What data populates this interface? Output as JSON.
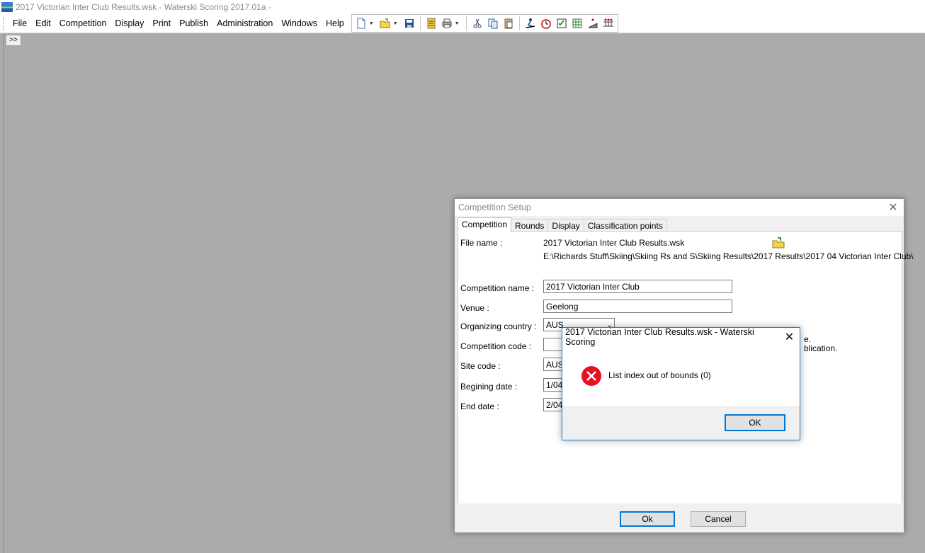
{
  "window": {
    "title": "2017 Victorian Inter Club Results.wsk - Waterski Scoring 2017.01a  -"
  },
  "menu": [
    "File",
    "Edit",
    "Competition",
    "Display",
    "Print",
    "Publish",
    "Administration",
    "Windows",
    "Help"
  ],
  "mdi": {
    "expand_label": ">>"
  },
  "setup_dialog": {
    "title": "Competition Setup",
    "tabs": [
      "Competition",
      "Rounds",
      "Display",
      "Classification points"
    ],
    "file_name_label": "File name :",
    "file_name_value": "2017 Victorian Inter Club Results.wsk",
    "file_path_value": "E:\\Richards Stuff\\Skiing\\Skiing Rs and S\\Skiing Results\\2017 Results\\2017 04 Victorian Inter Club\\",
    "competition_name_label": "Competition name :",
    "competition_name_value": "2017 Victorian Inter Club",
    "venue_label": "Venue :",
    "venue_value": "Geelong",
    "organizing_country_label": "Organizing country :",
    "organizing_country_value": "AUS",
    "competition_code_label": "Competition code :",
    "competition_code_value": "",
    "site_code_label": "Site code :",
    "site_code_value": "AUS3",
    "begin_date_label": "Begining date :",
    "begin_date_value": "1/04/",
    "end_date_label": "End date :",
    "end_date_value": "2/04/",
    "hint_line1": "e.",
    "hint_line2": "blication.",
    "ok_label": "Ok",
    "cancel_label": "Cancel"
  },
  "error_dialog": {
    "title": "2017 Victorian Inter Club Results.wsk - Waterski Scoring",
    "message": "List index out of bounds (0)",
    "ok_label": "OK"
  },
  "colors": {
    "accent": "#0078d7",
    "error": "#e81123",
    "mdi_background": "#ababab"
  }
}
